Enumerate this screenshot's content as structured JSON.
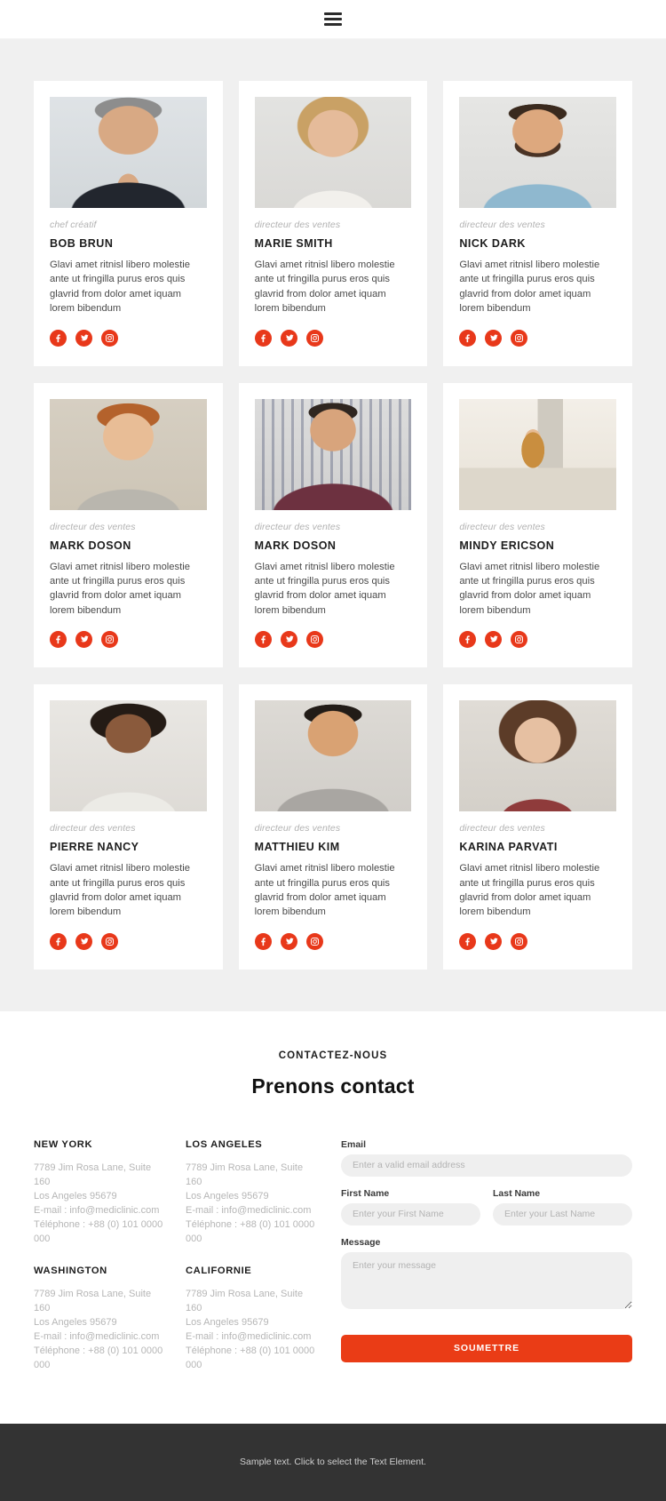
{
  "header": {
    "menu_icon": "hamburger-menu-icon"
  },
  "team": {
    "members": [
      {
        "role": "chef créatif",
        "name": "BOB BRUN",
        "desc": "Glavi amet ritnisl libero molestie ante ut fringilla purus eros quis glavrid from dolor amet iquam lorem bibendum",
        "photo": "portrait-man-grey-hair-suit"
      },
      {
        "role": "directeur des ventes",
        "name": "MARIE SMITH",
        "desc": "Glavi amet ritnisl libero molestie ante ut fringilla purus eros quis glavrid from dolor amet iquam lorem bibendum",
        "photo": "portrait-blonde-woman-smiling"
      },
      {
        "role": "directeur des ventes",
        "name": "NICK DARK",
        "desc": "Glavi amet ritnisl libero molestie ante ut fringilla purus eros quis glavrid from dolor amet iquam lorem bibendum",
        "photo": "portrait-bearded-man-blue-shirt"
      },
      {
        "role": "directeur des ventes",
        "name": "MARK DOSON",
        "desc": "Glavi amet ritnisl libero molestie ante ut fringilla purus eros quis glavrid from dolor amet iquam lorem bibendum",
        "photo": "portrait-young-man-hoodie"
      },
      {
        "role": "directeur des ventes",
        "name": "MARK DOSON",
        "desc": "Glavi amet ritnisl libero molestie ante ut fringilla purus eros quis glavrid from dolor amet iquam lorem bibendum",
        "photo": "portrait-man-plaid-shirt"
      },
      {
        "role": "directeur des ventes",
        "name": "MINDY ERICSON",
        "desc": "Glavi amet ritnisl libero molestie ante ut fringilla purus eros quis glavrid from dolor amet iquam lorem bibendum",
        "photo": "woman-working-at-office-desk"
      },
      {
        "role": "directeur des ventes",
        "name": "PIERRE NANCY",
        "desc": "Glavi amet ritnisl libero molestie ante ut fringilla purus eros quis glavrid from dolor amet iquam lorem bibendum",
        "photo": "portrait-curly-hair-woman-glasses"
      },
      {
        "role": "directeur des ventes",
        "name": "MATTHIEU KIM",
        "desc": "Glavi amet ritnisl libero molestie ante ut fringilla purus eros quis glavrid from dolor amet iquam lorem bibendum",
        "photo": "portrait-laughing-man-grey-tshirt"
      },
      {
        "role": "directeur des ventes",
        "name": "KARINA PARVATI",
        "desc": "Glavi amet ritnisl libero molestie ante ut fringilla purus eros quis glavrid from dolor amet iquam lorem bibendum",
        "photo": "portrait-brown-hair-woman"
      }
    ],
    "social": [
      {
        "icon": "facebook-icon",
        "label": "Facebook"
      },
      {
        "icon": "twitter-icon",
        "label": "Twitter"
      },
      {
        "icon": "instagram-icon",
        "label": "Instagram"
      }
    ]
  },
  "contact": {
    "eyebrow": "CONTACTEZ-NOUS",
    "title": "Prenons contact",
    "offices": [
      {
        "city": "NEW YORK",
        "address": "7789 Jim Rosa Lane, Suite 160\nLos Angeles 95679\nE-mail : info@mediclinic.com\nTéléphone : +88 (0) 101 0000 000"
      },
      {
        "city": "LOS ANGELES",
        "address": "7789 Jim Rosa Lane, Suite 160\nLos Angeles 95679\nE-mail : info@mediclinic.com\nTéléphone : +88 (0) 101 0000 000"
      },
      {
        "city": "WASHINGTON",
        "address": "7789 Jim Rosa Lane, Suite 160\nLos Angeles 95679\nE-mail : info@mediclinic.com\nTéléphone : +88 (0) 101 0000 000"
      },
      {
        "city": "CALIFORNIE",
        "address": "7789 Jim Rosa Lane, Suite 160\nLos Angeles 95679\nE-mail : info@mediclinic.com\nTéléphone : +88 (0) 101 0000 000"
      }
    ],
    "form": {
      "email_label": "Email",
      "email_placeholder": "Enter a valid email address",
      "email_value": "",
      "first_name_label": "First Name",
      "first_name_placeholder": "Enter your First Name",
      "first_name_value": "",
      "last_name_label": "Last Name",
      "last_name_placeholder": "Enter your Last Name",
      "last_name_value": "",
      "message_label": "Message",
      "message_placeholder": "Enter your message",
      "message_value": "",
      "submit_label": "SOUMETTRE"
    }
  },
  "footer": {
    "text": "Sample text. Click to select the Text Element."
  },
  "colors": {
    "accent": "#ea3c16",
    "social": "#e8381a",
    "section_bg": "#f0f0f0",
    "footer_bg": "#333333",
    "input_bg": "#efefef"
  }
}
